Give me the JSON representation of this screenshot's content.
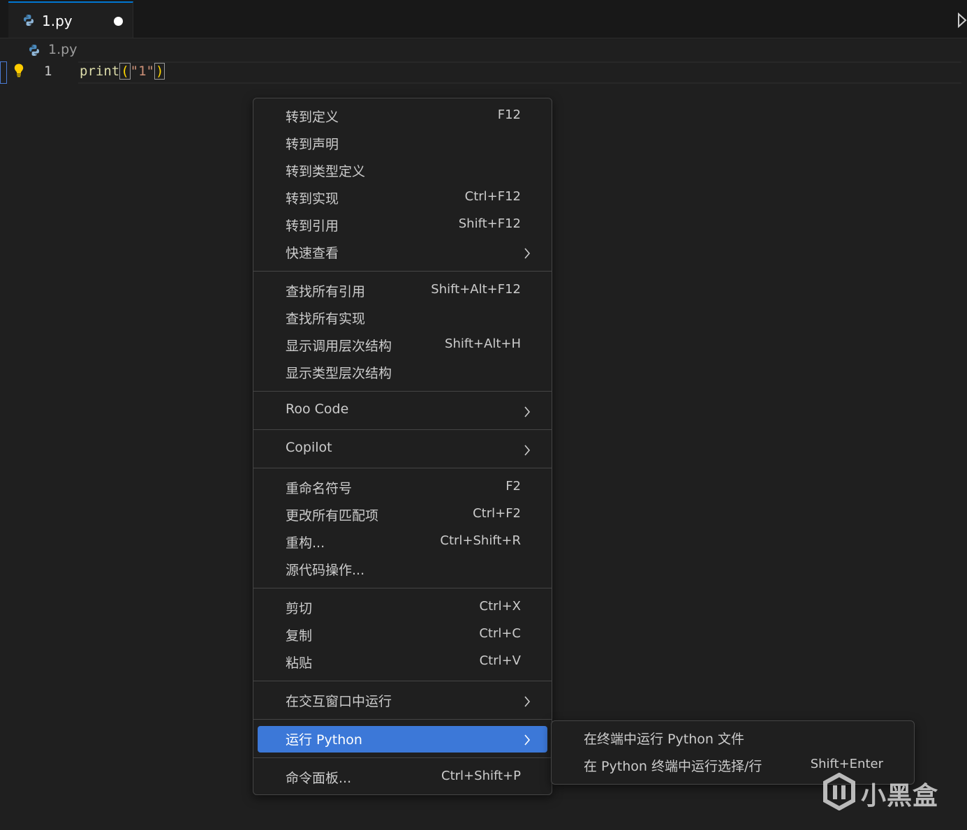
{
  "tab": {
    "filename": "1.py",
    "icon": "python-icon",
    "dirty": true
  },
  "toolbar": {
    "run_icon": "play-icon"
  },
  "breadcrumb": {
    "filename": "1.py"
  },
  "editor": {
    "line_number": "1",
    "code": {
      "fn": "print",
      "open": "(",
      "str": "\"1\"",
      "close": ")"
    },
    "colors": {
      "function": "#dcdcaa",
      "string": "#ce9178",
      "bracket": "#ffd700"
    }
  },
  "context_menu": {
    "active_color": "#3c78d8",
    "groups": [
      {
        "items": [
          {
            "label": "转到定义",
            "shortcut": "F12"
          },
          {
            "label": "转到声明",
            "shortcut": ""
          },
          {
            "label": "转到类型定义",
            "shortcut": ""
          },
          {
            "label": "转到实现",
            "shortcut": "Ctrl+F12"
          },
          {
            "label": "转到引用",
            "shortcut": "Shift+F12"
          },
          {
            "label": "快速查看",
            "shortcut": "",
            "submenu": true
          }
        ]
      },
      {
        "items": [
          {
            "label": "查找所有引用",
            "shortcut": "Shift+Alt+F12"
          },
          {
            "label": "查找所有实现",
            "shortcut": ""
          },
          {
            "label": "显示调用层次结构",
            "shortcut": "Shift+Alt+H"
          },
          {
            "label": "显示类型层次结构",
            "shortcut": ""
          }
        ]
      },
      {
        "items": [
          {
            "label": "Roo Code",
            "shortcut": "",
            "submenu": true
          }
        ]
      },
      {
        "items": [
          {
            "label": "Copilot",
            "shortcut": "",
            "submenu": true
          }
        ]
      },
      {
        "items": [
          {
            "label": "重命名符号",
            "shortcut": "F2"
          },
          {
            "label": "更改所有匹配项",
            "shortcut": "Ctrl+F2"
          },
          {
            "label": "重构...",
            "shortcut": "Ctrl+Shift+R"
          },
          {
            "label": "源代码操作...",
            "shortcut": ""
          }
        ]
      },
      {
        "items": [
          {
            "label": "剪切",
            "shortcut": "Ctrl+X"
          },
          {
            "label": "复制",
            "shortcut": "Ctrl+C"
          },
          {
            "label": "粘贴",
            "shortcut": "Ctrl+V"
          }
        ]
      },
      {
        "items": [
          {
            "label": "在交互窗口中运行",
            "shortcut": "",
            "submenu": true
          }
        ]
      },
      {
        "items": [
          {
            "label": "运行 Python",
            "shortcut": "",
            "submenu": true,
            "active": true
          }
        ]
      },
      {
        "items": [
          {
            "label": "命令面板...",
            "shortcut": "Ctrl+Shift+P"
          }
        ]
      }
    ]
  },
  "submenu": {
    "items": [
      {
        "label": "在终端中运行 Python 文件",
        "shortcut": ""
      },
      {
        "label": "在 Python 终端中运行选择/行",
        "shortcut": "Shift+Enter"
      }
    ]
  },
  "watermark": {
    "text": "小黑盒"
  }
}
